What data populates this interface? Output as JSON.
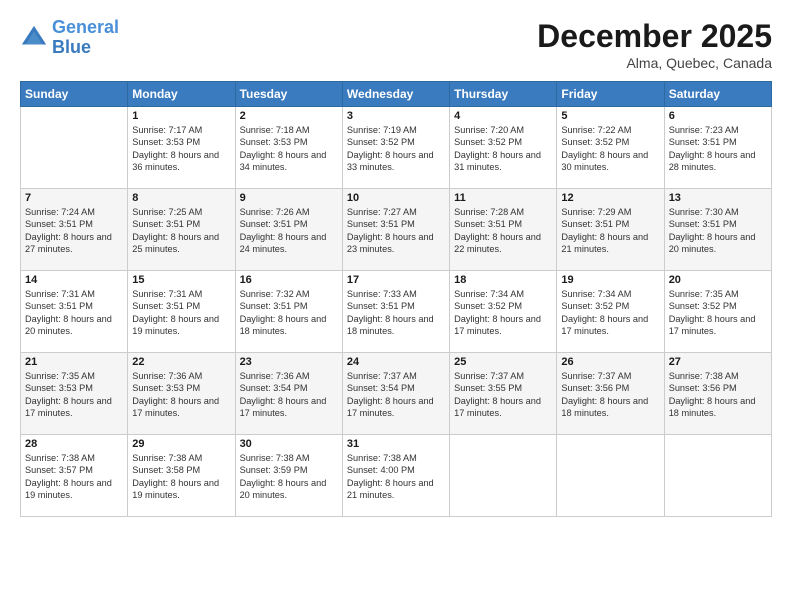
{
  "header": {
    "logo_line1": "General",
    "logo_line2": "Blue",
    "month": "December 2025",
    "location": "Alma, Quebec, Canada"
  },
  "weekdays": [
    "Sunday",
    "Monday",
    "Tuesday",
    "Wednesday",
    "Thursday",
    "Friday",
    "Saturday"
  ],
  "weeks": [
    [
      {
        "day": "",
        "info": ""
      },
      {
        "day": "1",
        "info": "Sunrise: 7:17 AM\nSunset: 3:53 PM\nDaylight: 8 hours\nand 36 minutes."
      },
      {
        "day": "2",
        "info": "Sunrise: 7:18 AM\nSunset: 3:53 PM\nDaylight: 8 hours\nand 34 minutes."
      },
      {
        "day": "3",
        "info": "Sunrise: 7:19 AM\nSunset: 3:52 PM\nDaylight: 8 hours\nand 33 minutes."
      },
      {
        "day": "4",
        "info": "Sunrise: 7:20 AM\nSunset: 3:52 PM\nDaylight: 8 hours\nand 31 minutes."
      },
      {
        "day": "5",
        "info": "Sunrise: 7:22 AM\nSunset: 3:52 PM\nDaylight: 8 hours\nand 30 minutes."
      },
      {
        "day": "6",
        "info": "Sunrise: 7:23 AM\nSunset: 3:51 PM\nDaylight: 8 hours\nand 28 minutes."
      }
    ],
    [
      {
        "day": "7",
        "info": "Sunrise: 7:24 AM\nSunset: 3:51 PM\nDaylight: 8 hours\nand 27 minutes."
      },
      {
        "day": "8",
        "info": "Sunrise: 7:25 AM\nSunset: 3:51 PM\nDaylight: 8 hours\nand 25 minutes."
      },
      {
        "day": "9",
        "info": "Sunrise: 7:26 AM\nSunset: 3:51 PM\nDaylight: 8 hours\nand 24 minutes."
      },
      {
        "day": "10",
        "info": "Sunrise: 7:27 AM\nSunset: 3:51 PM\nDaylight: 8 hours\nand 23 minutes."
      },
      {
        "day": "11",
        "info": "Sunrise: 7:28 AM\nSunset: 3:51 PM\nDaylight: 8 hours\nand 22 minutes."
      },
      {
        "day": "12",
        "info": "Sunrise: 7:29 AM\nSunset: 3:51 PM\nDaylight: 8 hours\nand 21 minutes."
      },
      {
        "day": "13",
        "info": "Sunrise: 7:30 AM\nSunset: 3:51 PM\nDaylight: 8 hours\nand 20 minutes."
      }
    ],
    [
      {
        "day": "14",
        "info": "Sunrise: 7:31 AM\nSunset: 3:51 PM\nDaylight: 8 hours\nand 20 minutes."
      },
      {
        "day": "15",
        "info": "Sunrise: 7:31 AM\nSunset: 3:51 PM\nDaylight: 8 hours\nand 19 minutes."
      },
      {
        "day": "16",
        "info": "Sunrise: 7:32 AM\nSunset: 3:51 PM\nDaylight: 8 hours\nand 18 minutes."
      },
      {
        "day": "17",
        "info": "Sunrise: 7:33 AM\nSunset: 3:51 PM\nDaylight: 8 hours\nand 18 minutes."
      },
      {
        "day": "18",
        "info": "Sunrise: 7:34 AM\nSunset: 3:52 PM\nDaylight: 8 hours\nand 17 minutes."
      },
      {
        "day": "19",
        "info": "Sunrise: 7:34 AM\nSunset: 3:52 PM\nDaylight: 8 hours\nand 17 minutes."
      },
      {
        "day": "20",
        "info": "Sunrise: 7:35 AM\nSunset: 3:52 PM\nDaylight: 8 hours\nand 17 minutes."
      }
    ],
    [
      {
        "day": "21",
        "info": "Sunrise: 7:35 AM\nSunset: 3:53 PM\nDaylight: 8 hours\nand 17 minutes."
      },
      {
        "day": "22",
        "info": "Sunrise: 7:36 AM\nSunset: 3:53 PM\nDaylight: 8 hours\nand 17 minutes."
      },
      {
        "day": "23",
        "info": "Sunrise: 7:36 AM\nSunset: 3:54 PM\nDaylight: 8 hours\nand 17 minutes."
      },
      {
        "day": "24",
        "info": "Sunrise: 7:37 AM\nSunset: 3:54 PM\nDaylight: 8 hours\nand 17 minutes."
      },
      {
        "day": "25",
        "info": "Sunrise: 7:37 AM\nSunset: 3:55 PM\nDaylight: 8 hours\nand 17 minutes."
      },
      {
        "day": "26",
        "info": "Sunrise: 7:37 AM\nSunset: 3:56 PM\nDaylight: 8 hours\nand 18 minutes."
      },
      {
        "day": "27",
        "info": "Sunrise: 7:38 AM\nSunset: 3:56 PM\nDaylight: 8 hours\nand 18 minutes."
      }
    ],
    [
      {
        "day": "28",
        "info": "Sunrise: 7:38 AM\nSunset: 3:57 PM\nDaylight: 8 hours\nand 19 minutes."
      },
      {
        "day": "29",
        "info": "Sunrise: 7:38 AM\nSunset: 3:58 PM\nDaylight: 8 hours\nand 19 minutes."
      },
      {
        "day": "30",
        "info": "Sunrise: 7:38 AM\nSunset: 3:59 PM\nDaylight: 8 hours\nand 20 minutes."
      },
      {
        "day": "31",
        "info": "Sunrise: 7:38 AM\nSunset: 4:00 PM\nDaylight: 8 hours\nand 21 minutes."
      },
      {
        "day": "",
        "info": ""
      },
      {
        "day": "",
        "info": ""
      },
      {
        "day": "",
        "info": ""
      }
    ]
  ]
}
